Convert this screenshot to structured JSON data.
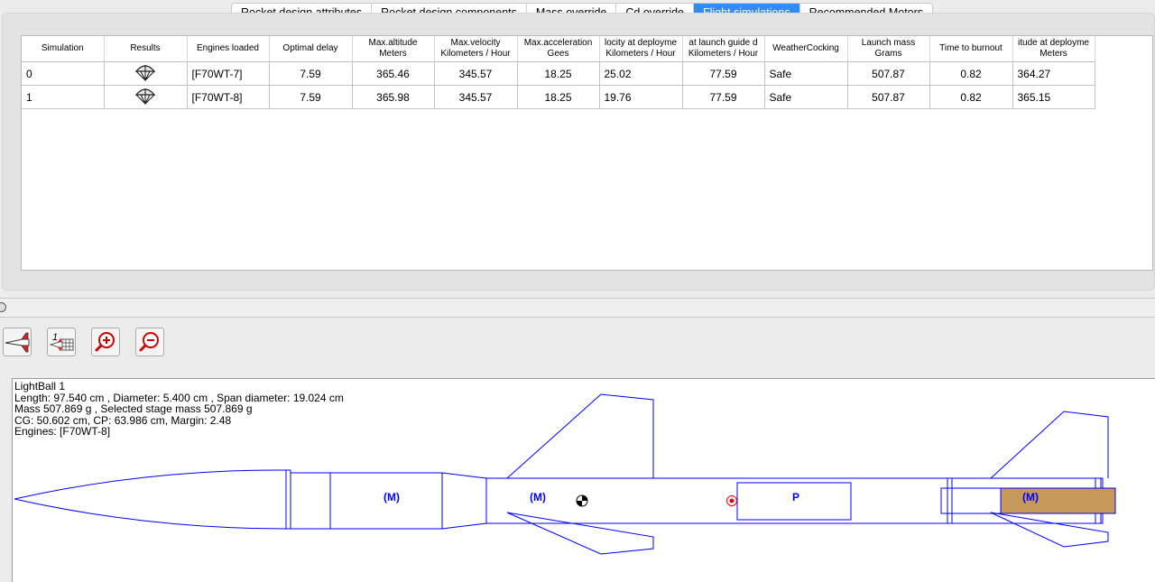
{
  "tabs": [
    {
      "label": "Rocket design attributes",
      "active": false
    },
    {
      "label": "Rocket design components",
      "active": false
    },
    {
      "label": "Mass override",
      "active": false
    },
    {
      "label": "Cd override",
      "active": false
    },
    {
      "label": "Flight simulations",
      "active": true
    },
    {
      "label": "Recommended Motors",
      "active": false
    }
  ],
  "table": {
    "headers": [
      {
        "l1": "Simulation",
        "l2": ""
      },
      {
        "l1": "Results",
        "l2": ""
      },
      {
        "l1": "Engines loaded",
        "l2": ""
      },
      {
        "l1": "Optimal delay",
        "l2": ""
      },
      {
        "l1": "Max.altitude",
        "l2": "Meters"
      },
      {
        "l1": "Max.velocity",
        "l2": "Kilometers / Hour"
      },
      {
        "l1": "Max.acceleration",
        "l2": "Gees"
      },
      {
        "l1": "locity at deployme",
        "l2": "Kilometers / Hour"
      },
      {
        "l1": "at launch guide d",
        "l2": "Kilometers / Hour"
      },
      {
        "l1": "WeatherCocking",
        "l2": ""
      },
      {
        "l1": "Launch mass",
        "l2": "Grams"
      },
      {
        "l1": "Time to burnout",
        "l2": ""
      },
      {
        "l1": "itude at deployme",
        "l2": "Meters"
      }
    ],
    "rows": [
      {
        "sim": "0",
        "result_icon": "parachute-icon",
        "engines": "[F70WT-7]",
        "delay": "7.59",
        "max_alt": "365.46",
        "max_vel": "345.57",
        "max_acc": "18.25",
        "vel_deploy": "25.02",
        "vel_guide": "77.59",
        "weathercocking": "Safe",
        "launch_mass": "507.87",
        "burnout": "0.82",
        "alt_deploy": "364.27"
      },
      {
        "sim": "1",
        "result_icon": "parachute-icon",
        "engines": "[F70WT-8]",
        "delay": "7.59",
        "max_alt": "365.98",
        "max_vel": "345.57",
        "max_acc": "18.25",
        "vel_deploy": "19.76",
        "vel_guide": "77.59",
        "weathercocking": "Safe",
        "launch_mass": "507.87",
        "burnout": "0.82",
        "alt_deploy": "365.15"
      }
    ]
  },
  "toolbar": [
    {
      "name": "rocket-view-icon"
    },
    {
      "name": "stage-table-icon"
    },
    {
      "name": "zoom-in-icon"
    },
    {
      "name": "zoom-out-icon"
    }
  ],
  "design": {
    "name": "LightBall 1",
    "line1": "Length: 97.540  cm , Diameter: 5.400  cm , Span diameter: 19.024  cm",
    "line2": "Mass 507.869 g , Selected stage mass 507.869 g",
    "line3": "CG: 50.602 cm, CP: 63.986 cm, Margin: 2.48",
    "line4": "Engines: [F70WT-8]",
    "mass_label": "(M)",
    "parachute_label": "P",
    "outline_color": "#0000ff",
    "motor_color": "#c4995a"
  }
}
